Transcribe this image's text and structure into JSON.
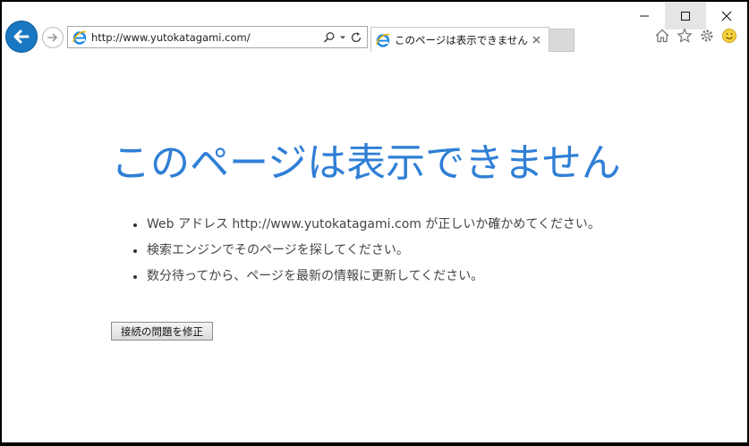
{
  "window": {
    "minimize_icon": "minimize-icon",
    "maximize_icon": "maximize-icon",
    "close_icon": "close-icon"
  },
  "nav": {
    "back_icon": "arrow-left-icon",
    "forward_icon": "arrow-right-icon",
    "address": "http://www.yutokatagami.com/",
    "search_icon": "search-icon",
    "refresh_icon": "refresh-icon"
  },
  "tab": {
    "title": "このページは表示できません"
  },
  "toolbar": {
    "icons": [
      "home-icon",
      "star-icon",
      "gear-icon",
      "smiley-icon"
    ]
  },
  "page": {
    "heading": "このページは表示できません",
    "suggestions": [
      "Web アドレス http://www.yutokatagami.com が正しいか確かめてください。",
      "検索エンジンでそのページを探してください。",
      "数分待ってから、ページを最新の情報に更新してください。"
    ],
    "fix_button": "接続の問題を修正"
  },
  "colors": {
    "heading": "#2f7fd6",
    "back_button": "#1a78c2"
  }
}
